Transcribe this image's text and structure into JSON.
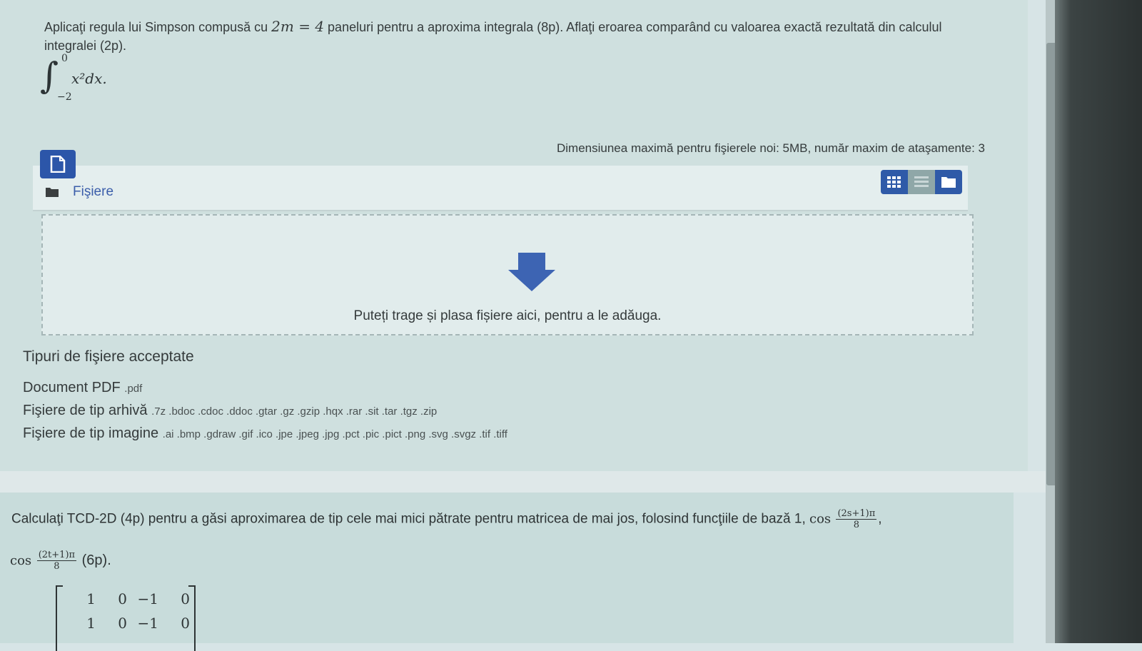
{
  "question1": {
    "text_prefix": "Aplicaţi regula lui Simpson compusă cu ",
    "math_m": "2m = 4",
    "text_suffix": " paneluri pentru a aproxima integrala (8p). Aflaţi eroarea comparând cu valoarea exactă rezultată din calculul integralei (2p).",
    "integral": {
      "upper": "0",
      "lower": "−2",
      "body": "x²dx."
    }
  },
  "file_manager": {
    "max_size_text": "Dimensiunea maximă pentru fişierele noi: 5MB, număr maxim de ataşamente: 3",
    "files_label": "Fişiere",
    "dropzone_text": "Puteți trage și plasa fișiere aici, pentru a le adăuga.",
    "icons": {
      "add": "file-add-icon",
      "folder": "folder-icon",
      "grid": "grid-view-icon",
      "list": "list-view-icon",
      "tree": "folder-view-icon",
      "drop": "download-arrow-icon"
    }
  },
  "accepted_types": {
    "title": "Tipuri de fişiere acceptate",
    "items": [
      {
        "label": "Document PDF",
        "exts": ".pdf"
      },
      {
        "label": "Fişiere de tip arhivă",
        "exts": ".7z .bdoc .cdoc .ddoc .gtar .gz .gzip .hqx .rar .sit .tar .tgz .zip"
      },
      {
        "label": "Fişiere de tip imagine",
        "exts": ".ai .bmp .gdraw .gif .ico .jpe .jpeg .jpg .pct .pic .pict .png .svg .svgz .tif .tiff"
      }
    ]
  },
  "question2": {
    "text": "Calculaţi TCD-2D (4p) pentru a găsi aproximarea de tip cele mai mici pătrate pentru matricea de mai jos, folosind funcţiile de bază 1,",
    "cos1": "cos",
    "frac1_num": "(2s+1)π",
    "frac1_den": "8",
    "after1": ",",
    "cos2": "cos",
    "frac2_num": "(2t+1)π",
    "frac2_den": "8",
    "after2": "(6p).",
    "matrix_rows": [
      [
        "1",
        "0",
        "−1",
        "0"
      ],
      [
        "1",
        "0",
        "−1",
        "0"
      ]
    ]
  },
  "colors": {
    "accent": "#2c56a9",
    "panel": "#cfe0df"
  }
}
